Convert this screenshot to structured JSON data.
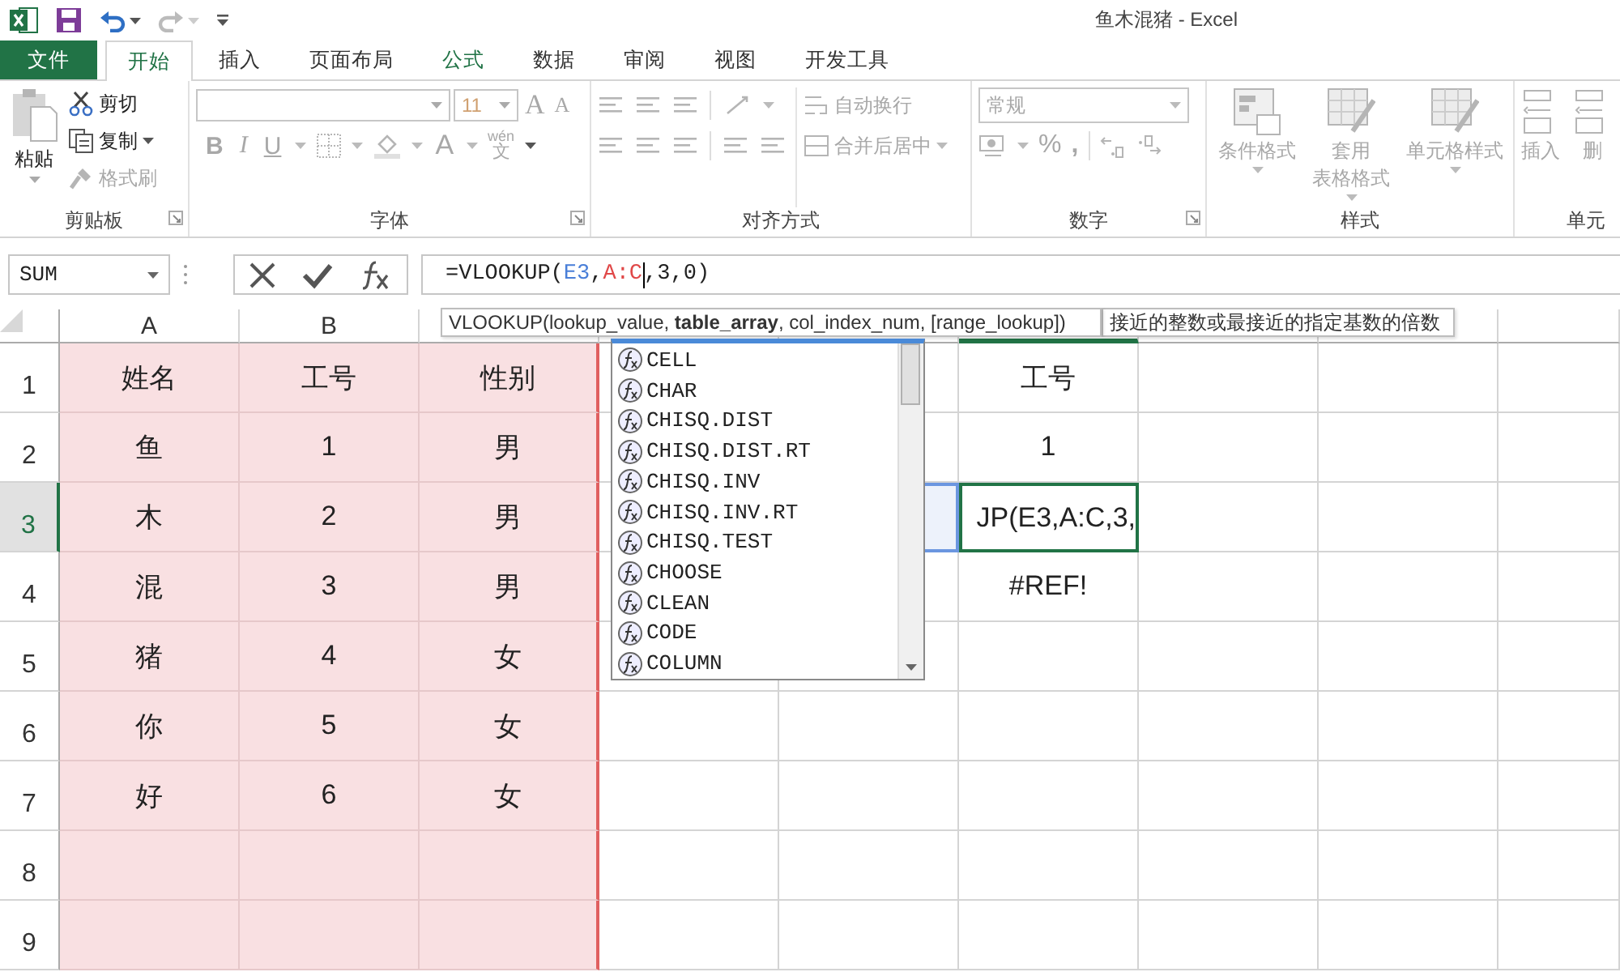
{
  "window": {
    "title": "鱼木混猪 - Excel"
  },
  "ribbon_tabs": [
    {
      "label": "文件",
      "kind": "file",
      "selected": false
    },
    {
      "label": "开始",
      "kind": "tab",
      "selected": true
    },
    {
      "label": "插入",
      "kind": "tab",
      "selected": false
    },
    {
      "label": "页面布局",
      "kind": "tab",
      "selected": false
    },
    {
      "label": "公式",
      "kind": "accent",
      "selected": false
    },
    {
      "label": "数据",
      "kind": "tab",
      "selected": false
    },
    {
      "label": "审阅",
      "kind": "tab",
      "selected": false
    },
    {
      "label": "视图",
      "kind": "tab",
      "selected": false
    },
    {
      "label": "开发工具",
      "kind": "tab",
      "selected": false
    }
  ],
  "ribbon": {
    "clipboard": {
      "label": "剪贴板",
      "paste": {
        "label": "粘贴",
        "disabled": true
      },
      "cut": {
        "label": "剪切",
        "disabled": false
      },
      "copy": {
        "label": "复制",
        "disabled": false
      },
      "format_painter": {
        "label": "格式刷",
        "disabled": true
      }
    },
    "font": {
      "label": "字体",
      "disabled": true,
      "size": "11",
      "grow_font": "A",
      "shrink_font": "A",
      "bold": "B",
      "italic": "I",
      "underline": "U",
      "font_color": "A",
      "phonetic": "wén",
      "phonetic_base": "文"
    },
    "alignment": {
      "label": "对齐方式",
      "disabled": true,
      "wrap_text": "自动换行",
      "merge_center": "合并后居中"
    },
    "number": {
      "label": "数字",
      "disabled": true,
      "format": "常规",
      "percent": "%",
      "comma": ","
    },
    "styles": {
      "label": "样式",
      "disabled": true,
      "items": [
        {
          "lines": [
            "条件格式"
          ]
        },
        {
          "lines": [
            "套用",
            "表格格式"
          ]
        },
        {
          "lines": [
            "单元格样式"
          ]
        }
      ]
    },
    "cells": {
      "label": "单元",
      "disabled": true,
      "items": [
        {
          "lines": [
            "插入"
          ]
        },
        {
          "lines": [
            "删"
          ]
        }
      ]
    }
  },
  "formula_bar": {
    "name_box": "SUM",
    "formula": [
      {
        "text": "=VLOOKUP("
      },
      {
        "text": "E3",
        "color": "#4a7fd8"
      },
      {
        "text": ","
      },
      {
        "text": "A:C",
        "color": "#e04848"
      },
      {
        "text": ",3,0)"
      }
    ]
  },
  "sheet": {
    "columns": [
      {
        "label": "A",
        "selected": false,
        "shaded": true
      },
      {
        "label": "B",
        "selected": false,
        "shaded": true
      },
      {
        "selected": false,
        "shaded": true
      },
      {
        "selected": false,
        "shaded": false
      },
      {
        "selected": false,
        "shaded": false
      },
      {
        "selected": true,
        "shaded": false
      },
      {
        "selected": false,
        "shaded": false
      },
      {
        "selected": false,
        "shaded": false
      },
      {
        "selected": false,
        "shaded": false
      }
    ],
    "rows": [
      {
        "header": "1",
        "selected": false,
        "reference_highlight": false,
        "values": [
          "姓名",
          "工号",
          "性别"
        ],
        "lookup": {
          "text": "工号",
          "editing": false
        }
      },
      {
        "header": "2",
        "selected": false,
        "reference_highlight": false,
        "values": [
          "鱼",
          "1",
          "男"
        ],
        "lookup": {
          "text": "1",
          "editing": false
        }
      },
      {
        "header": "3",
        "selected": true,
        "reference_highlight": true,
        "values": [
          "木",
          "2",
          "男"
        ],
        "lookup": {
          "text": "JP(E3,A:C,3,",
          "editing": true
        }
      },
      {
        "header": "4",
        "selected": false,
        "reference_highlight": false,
        "values": [
          "混",
          "3",
          "男"
        ],
        "lookup": {
          "text": "#REF!",
          "editing": false
        }
      },
      {
        "header": "5",
        "selected": false,
        "reference_highlight": false,
        "values": [
          "猪",
          "4",
          "女"
        ]
      },
      {
        "header": "6",
        "selected": false,
        "reference_highlight": false,
        "values": [
          "你",
          "5",
          "女"
        ]
      },
      {
        "header": "7",
        "selected": false,
        "reference_highlight": false,
        "values": [
          "好",
          "6",
          "女"
        ]
      },
      {
        "header": "8",
        "selected": false,
        "reference_highlight": false
      },
      {
        "header": "9",
        "selected": false,
        "reference_highlight": false
      }
    ]
  },
  "signature_tooltip": "VLOOKUP(lookup_value, **table_array**, col_index_num, [range_lookup])",
  "description_tooltip": "接近的整数或最接近的指定基数的倍数",
  "autocomplete": [
    "CELL",
    "CHAR",
    "CHISQ.DIST",
    "CHISQ.DIST.RT",
    "CHISQ.INV",
    "CHISQ.INV.RT",
    "CHISQ.TEST",
    "CHOOSE",
    "CLEAN",
    "CODE",
    "COLUMN"
  ]
}
